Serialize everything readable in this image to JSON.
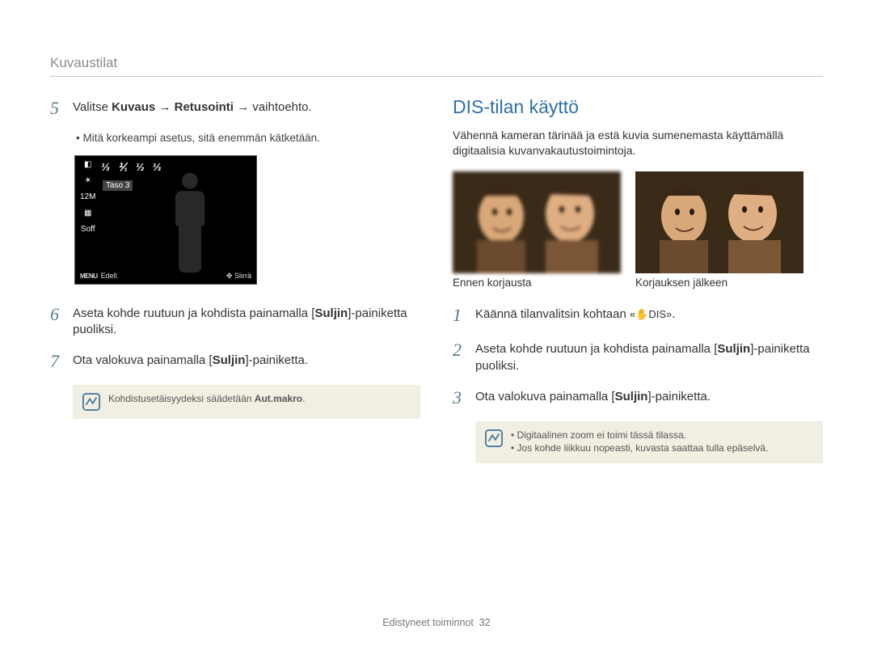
{
  "header": "Kuvaustilat",
  "left": {
    "step5": {
      "num": "5",
      "pre": "Valitse ",
      "b1": "Kuvaus",
      "arrow1": " → ",
      "b2": "Retusointi",
      "arrow2": " → ",
      "post": "vaihtoehto."
    },
    "sub5": "Mitä korkeampi asetus, sitä enemmän kätketään.",
    "lcd": {
      "fractions": [
        "⅓",
        "⅟₁",
        "½",
        "⅓"
      ],
      "left_icons": [
        "◧",
        "☀",
        "12M",
        "▦",
        "Soff"
      ],
      "label": "Taso 3",
      "menu": "MENU",
      "back": "Edell.",
      "move_icon": "✥",
      "move": "Siirrä"
    },
    "step6": {
      "num": "6",
      "pre": "Aseta kohde ruutuun ja kohdista painamalla [",
      "b": "Suljin",
      "post": "]-painiketta puoliksi."
    },
    "step7": {
      "num": "7",
      "pre": "Ota valokuva painamalla [",
      "b": "Suljin",
      "post": "]-painiketta."
    },
    "note": {
      "pre": "Kohdistusetäisyydeksi säädetään ",
      "b": "Aut.makro",
      "post": "."
    }
  },
  "right": {
    "heading": "DIS-tilan käyttö",
    "intro": "Vähennä kameran tärinää ja estä kuvia sumenemasta käyttämällä digitaalisia kuvanvakautustoimintoja.",
    "photo_before": "Ennen korjausta",
    "photo_after": "Korjauksen jälkeen",
    "step1": {
      "num": "1",
      "text": "Käännä tilanvalitsin kohtaan ",
      "icon": "«✋DIS»",
      "post": "."
    },
    "step2": {
      "num": "2",
      "pre": "Aseta kohde ruutuun ja kohdista painamalla [",
      "b": "Suljin",
      "post": "]-painiketta puoliksi."
    },
    "step3": {
      "num": "3",
      "pre": "Ota valokuva painamalla [",
      "b": "Suljin",
      "post": "]-painiketta."
    },
    "notes": [
      "Digitaalinen zoom ei toimi tässä tilassa.",
      "Jos kohde liikkuu nopeasti, kuvasta saattaa tulla epäselvä."
    ]
  },
  "footer": {
    "section": "Edistyneet toiminnot",
    "page": "32"
  }
}
